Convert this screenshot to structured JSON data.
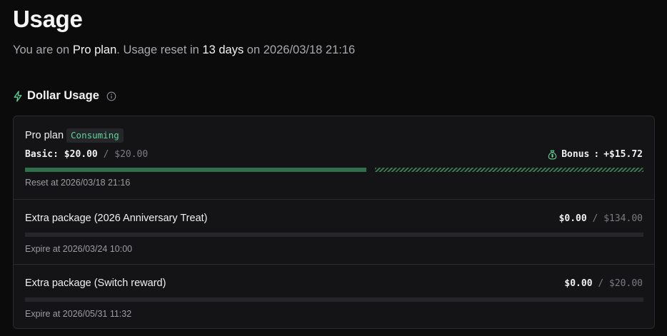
{
  "page": {
    "title": "Usage",
    "subtitle": {
      "prefix": "You are on ",
      "plan": "Pro plan",
      "middle": ". Usage reset in ",
      "days": "13 days",
      "on_text": " on ",
      "date": "2026/03/18 21:16"
    }
  },
  "dollar_usage": {
    "heading": "Dollar Usage",
    "icon": "lightning-bolt-icon",
    "info_icon": "info-circle-icon",
    "accent_color": "#5fd39a",
    "plan": {
      "name": "Pro plan",
      "status": "Consuming",
      "basic_label": "Basic:",
      "basic_used": "$20.00",
      "basic_separator": "/",
      "basic_total": "$20.00",
      "basic_fill_fraction": 1.0,
      "bonus_icon": "money-bag-icon",
      "bonus_label": "Bonus",
      "bonus_separator": ":",
      "bonus_value": "+$15.72",
      "reset_text": "Reset at 2026/03/18 21:16"
    },
    "packages": [
      {
        "title": "Extra package (2026 Anniversary Treat)",
        "used": "$0.00",
        "separator": "/",
        "total": "$134.00",
        "fill_fraction": 0,
        "expire_text": "Expire at 2026/03/24 10:00"
      },
      {
        "title": "Extra package (Switch reward)",
        "used": "$0.00",
        "separator": "/",
        "total": "$20.00",
        "fill_fraction": 0,
        "expire_text": "Expire at 2026/05/31 11:32"
      }
    ]
  }
}
